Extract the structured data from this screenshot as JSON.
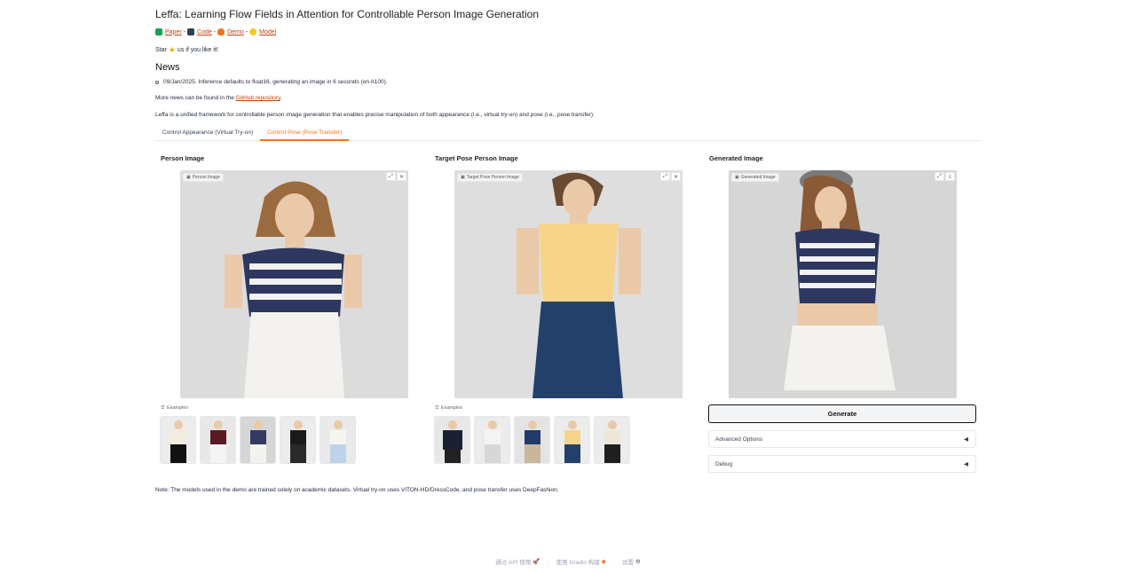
{
  "header": {
    "title": "Leffa: Learning Flow Fields in Attention for Controllable Person Image Generation",
    "links": [
      {
        "label": "Paper",
        "icon": "book-emoji",
        "color": "#16a34a"
      },
      {
        "label": "Code",
        "icon": "cat-emoji",
        "color": "#334155"
      },
      {
        "label": "Demo",
        "icon": "fire-emoji",
        "color": "#f97316"
      },
      {
        "label": "Model",
        "icon": "hugging-face-emoji",
        "color": "#facc15"
      }
    ],
    "separator": "-",
    "star_prefix": "Star",
    "star_suffix": "us if you like it!"
  },
  "news": {
    "heading": "News",
    "items": [
      "09/Jan/2025. Inference defaults to float16, generating an image in 6 seconds (on A100)."
    ],
    "more_prefix": "More news can be found in the",
    "more_link": "GitHub repository",
    "more_suffix": "."
  },
  "description": "Leffa is a unified framework for controllable person image generation that enables precise manipulation of both appearance (i.e., virtual try-on) and pose (i.e., pose transfer).",
  "tabs": [
    {
      "label": "Control Appearance (Virtual Try-on)",
      "active": false
    },
    {
      "label": "Control Pose (Pose Transfer)",
      "active": true
    }
  ],
  "columns": {
    "person": {
      "label": "Person Image",
      "chip": "Person Image",
      "examples_label": "Examples"
    },
    "target": {
      "label": "Target Pose Person Image",
      "chip": "Target Pose Person Image",
      "examples_label": "Examples"
    },
    "generated": {
      "label": "Generated Image",
      "chip": "Generated Image"
    }
  },
  "controls": {
    "generate": "Generate",
    "advanced": "Advanced Options",
    "debug": "Debug",
    "collapse_icon": "◀"
  },
  "note": "Note: The models used in the demo are trained solely on academic datasets. Virtual try-on uses VITON-HD/DressCode, and pose transfer uses DeepFashion.",
  "footer": {
    "api": "通过 API 使用",
    "built": "使用 Gradio 构建",
    "settings": "设置",
    "sep": "·"
  },
  "colors": {
    "accent": "#f97316",
    "link": "#c2410c"
  }
}
